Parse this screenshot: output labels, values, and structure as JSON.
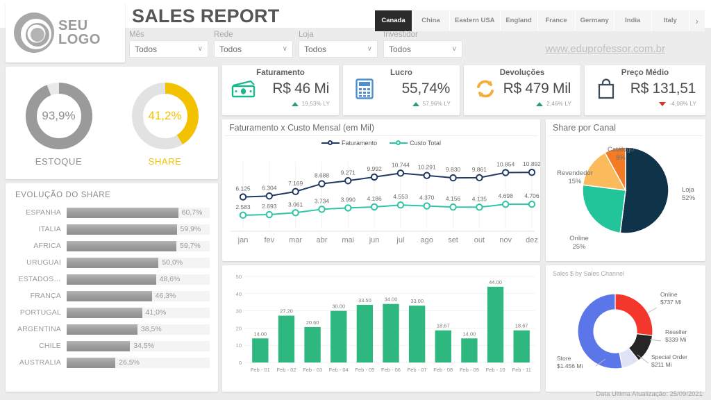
{
  "header": {
    "title": "SALES REPORT",
    "logo_line1": "SEU",
    "logo_line2": "LOGO",
    "website": "www.eduprofessor.com.br"
  },
  "country_tabs": {
    "items": [
      "Canada",
      "China",
      "Eastern USA",
      "England",
      "France",
      "Germany",
      "India",
      "Italy"
    ],
    "active": "Canada",
    "next_label": "›"
  },
  "filters": [
    {
      "label": "Mês",
      "value": "Todos"
    },
    {
      "label": "Rede",
      "value": "Todos"
    },
    {
      "label": "Loja",
      "value": "Todos"
    },
    {
      "label": "Investidor",
      "value": "Todos"
    }
  ],
  "gauges": [
    {
      "caption": "ESTOQUE",
      "value_label": "93,9%",
      "percent": 93.9,
      "color": "#9a9a9a",
      "track": "#e9e9e9"
    },
    {
      "caption": "SHARE",
      "value_label": "41,2%",
      "percent": 41.2,
      "color": "#f2c200",
      "track": "#e2e2e2"
    }
  ],
  "kpis": [
    {
      "title": "Faturamento",
      "value": "R$ 46 Mi",
      "delta": "19,53% LY",
      "direction": "up",
      "icon": "cash-icon",
      "icon_color": "#17b98a"
    },
    {
      "title": "Lucro",
      "value": "55,74%",
      "delta": "57,96% LY",
      "direction": "up",
      "icon": "calculator-icon",
      "icon_color": "#4f8fd1"
    },
    {
      "title": "Devoluções",
      "value": "R$ 479 Mil",
      "delta": "2,46% LY",
      "direction": "up",
      "icon": "refresh-icon",
      "icon_color": "#f5ae3c"
    },
    {
      "title": "Preço Médio",
      "value": "R$ 131,51",
      "delta": "-4,08% LY",
      "direction": "down",
      "icon": "shopping-bag-icon",
      "icon_color": "#3d4a57"
    }
  ],
  "share_evolution": {
    "title": "EVOLUÇÃO DO SHARE",
    "rows": [
      {
        "name": "ESPANHA",
        "label": "60,7%",
        "value": 60.7
      },
      {
        "name": "ITALIA",
        "label": "59,9%",
        "value": 59.9
      },
      {
        "name": "AFRICA",
        "label": "59,7%",
        "value": 59.7
      },
      {
        "name": "URUGUAI",
        "label": "50,0%",
        "value": 50.0
      },
      {
        "name": "ESTADOS…",
        "label": "48,6%",
        "value": 48.6
      },
      {
        "name": "FRANÇA",
        "label": "46,3%",
        "value": 46.3
      },
      {
        "name": "PORTUGAL",
        "label": "41,0%",
        "value": 41.0
      },
      {
        "name": "ARGENTINA",
        "label": "38,5%",
        "value": 38.5
      },
      {
        "name": "CHILE",
        "label": "34,5%",
        "value": 34.5
      },
      {
        "name": "AUSTRALIA",
        "label": "26,5%",
        "value": 26.5
      }
    ]
  },
  "footer": {
    "last_update": "Data Ultima Atualização: 25/09/2021"
  },
  "chart_data": [
    {
      "id": "faturamento-custo-mensal",
      "type": "line",
      "title": "Faturamento x Custo Mensal (em Mil)",
      "xlabel": "",
      "ylabel": "",
      "legend_position": "top-center",
      "grid": true,
      "categories": [
        "jan",
        "fev",
        "mar",
        "abr",
        "mai",
        "jun",
        "jul",
        "ago",
        "set",
        "out",
        "nov",
        "dez"
      ],
      "series": [
        {
          "name": "Faturamento",
          "color": "#1f3864",
          "values": [
            6125,
            6304,
            7169,
            8688,
            9271,
            9992,
            10744,
            10291,
            9830,
            9861,
            10854,
            10892
          ],
          "labels": [
            "6.125",
            "6.304",
            "7.169",
            "8.688",
            "9.271",
            "9.992",
            "10.744",
            "10.291",
            "9.830",
            "9.861",
            "10.854",
            "10.892"
          ]
        },
        {
          "name": "Custo Total",
          "color": "#2ec4a6",
          "values": [
            2583,
            2693,
            3061,
            3734,
            3990,
            4186,
            4553,
            4370,
            4156,
            4135,
            4698,
            4706
          ],
          "labels": [
            "2.583",
            "2.693",
            "3.061",
            "3.734",
            "3.990",
            "4.186",
            "4.553",
            "4.370",
            "4.156",
            "4.135",
            "4.698",
            "4.706"
          ]
        }
      ],
      "ylim": [
        0,
        12000
      ]
    },
    {
      "id": "sales-by-day",
      "type": "bar",
      "title": "",
      "xlabel": "",
      "ylabel": "",
      "grid": true,
      "categories": [
        "Feb - 01",
        "Feb - 02",
        "Feb - 03",
        "Feb - 04",
        "Feb - 05",
        "Feb - 06",
        "Feb - 07",
        "Feb - 08",
        "Feb - 09",
        "Feb - 10",
        "Feb - 11"
      ],
      "values": [
        14.0,
        27.2,
        20.6,
        30.0,
        33.5,
        34.0,
        33.0,
        18.67,
        14.0,
        44.0,
        18.67
      ],
      "labels": [
        "14.00",
        "27.20",
        "20.60",
        "30.00",
        "33.50",
        "34.00",
        "33.00",
        "18.67",
        "14.00",
        "44.00",
        "18.67"
      ],
      "bar_color": "#2eb87f",
      "ylim": [
        0,
        50
      ],
      "yticks": [
        "0",
        "10",
        "20",
        "30",
        "40",
        "50"
      ]
    },
    {
      "id": "share-por-canal",
      "type": "pie",
      "title": "Share por Canal",
      "slices": [
        {
          "name": "Loja",
          "label": "52%",
          "value": 52,
          "color": "#0f3349"
        },
        {
          "name": "Online",
          "label": "25%",
          "value": 25,
          "color": "#22c49a"
        },
        {
          "name": "Revendedor",
          "label": "15%",
          "value": 15,
          "color": "#fbbb5c"
        },
        {
          "name": "Catálogo",
          "label": "8%",
          "value": 8,
          "color": "#f47b25"
        }
      ]
    },
    {
      "id": "sales-by-sales-channel",
      "type": "pie",
      "title": "Sales $ by Sales Channel",
      "donut": true,
      "slices": [
        {
          "name": "Online",
          "label": "$737 Mi",
          "value": 737,
          "color": "#f4372c"
        },
        {
          "name": "Reseller",
          "label": "$339 Mi",
          "value": 339,
          "color": "#262626"
        },
        {
          "name": "Special Order",
          "label": "$211 Mi",
          "value": 211,
          "color": "#dfe3f5"
        },
        {
          "name": "Store",
          "label": "$1.456 Mi",
          "value": 1456,
          "color": "#5a76e8"
        }
      ]
    }
  ]
}
